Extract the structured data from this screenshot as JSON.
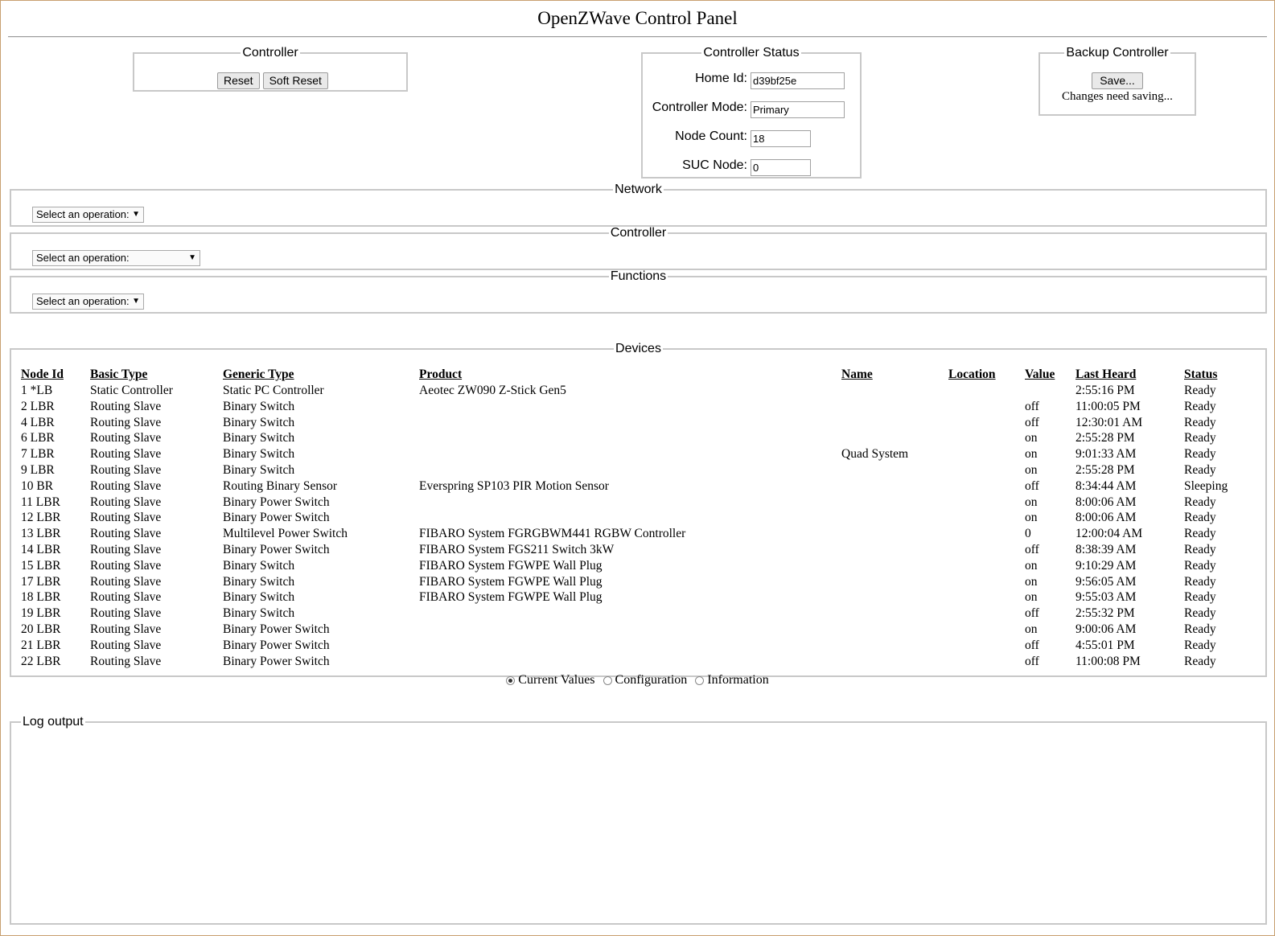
{
  "page": {
    "title": "OpenZWave Control Panel"
  },
  "controller": {
    "legend": "Controller",
    "reset_label": "Reset",
    "soft_reset_label": "Soft Reset"
  },
  "controller_status": {
    "legend": "Controller Status",
    "home_id_label": "Home Id:",
    "home_id": "d39bf25e",
    "mode_label": "Controller Mode:",
    "mode": "Primary",
    "node_count_label": "Node Count:",
    "node_count": "18",
    "suc_node_label": "SUC Node:",
    "suc_node": "0"
  },
  "backup": {
    "legend": "Backup Controller",
    "save_label": "Save...",
    "note": "Changes need saving..."
  },
  "network": {
    "legend": "Network",
    "select": "Select an operation:"
  },
  "controller_ops": {
    "legend": "Controller",
    "select": "Select an operation:"
  },
  "functions": {
    "legend": "Functions",
    "select": "Select an operation:"
  },
  "devices": {
    "legend": "Devices",
    "columns": [
      "Node Id",
      "Basic Type",
      "Generic Type",
      "Product",
      "Name",
      "Location",
      "Value",
      "Last Heard",
      "Status"
    ],
    "rows": [
      [
        "1 *LB",
        "Static Controller",
        "Static PC Controller",
        "Aeotec ZW090 Z-Stick Gen5",
        "",
        "",
        "",
        "2:55:16 PM",
        "Ready"
      ],
      [
        "2 LBR",
        "Routing Slave",
        "Binary Switch",
        "",
        "",
        "",
        "off",
        "11:00:05 PM",
        "Ready"
      ],
      [
        "4 LBR",
        "Routing Slave",
        "Binary Switch",
        "",
        "",
        "",
        "off",
        "12:30:01 AM",
        "Ready"
      ],
      [
        "6 LBR",
        "Routing Slave",
        "Binary Switch",
        "",
        "",
        "",
        "on",
        "2:55:28 PM",
        "Ready"
      ],
      [
        "7 LBR",
        "Routing Slave",
        "Binary Switch",
        "",
        "Quad System",
        "",
        "on",
        "9:01:33 AM",
        "Ready"
      ],
      [
        "9 LBR",
        "Routing Slave",
        "Binary Switch",
        "",
        "",
        "",
        "on",
        "2:55:28 PM",
        "Ready"
      ],
      [
        "10 BR",
        "Routing Slave",
        "Routing Binary Sensor",
        "Everspring SP103 PIR Motion Sensor",
        "",
        "",
        "off",
        "8:34:44 AM",
        "Sleeping"
      ],
      [
        "11 LBR",
        "Routing Slave",
        "Binary Power Switch",
        "",
        "",
        "",
        "on",
        "8:00:06 AM",
        "Ready"
      ],
      [
        "12 LBR",
        "Routing Slave",
        "Binary Power Switch",
        "",
        "",
        "",
        "on",
        "8:00:06 AM",
        "Ready"
      ],
      [
        "13 LBR",
        "Routing Slave",
        "Multilevel Power Switch",
        "FIBARO System FGRGBWM441 RGBW Controller",
        "",
        "",
        "0",
        "12:00:04 AM",
        "Ready"
      ],
      [
        "14 LBR",
        "Routing Slave",
        "Binary Power Switch",
        "FIBARO System FGS211 Switch 3kW",
        "",
        "",
        "off",
        "8:38:39 AM",
        "Ready"
      ],
      [
        "15 LBR",
        "Routing Slave",
        "Binary Switch",
        "FIBARO System FGWPE Wall Plug",
        "",
        "",
        "on",
        "9:10:29 AM",
        "Ready"
      ],
      [
        "17 LBR",
        "Routing Slave",
        "Binary Switch",
        "FIBARO System FGWPE Wall Plug",
        "",
        "",
        "on",
        "9:56:05 AM",
        "Ready"
      ],
      [
        "18 LBR",
        "Routing Slave",
        "Binary Switch",
        "FIBARO System FGWPE Wall Plug",
        "",
        "",
        "on",
        "9:55:03 AM",
        "Ready"
      ],
      [
        "19 LBR",
        "Routing Slave",
        "Binary Switch",
        "",
        "",
        "",
        "off",
        "2:55:32 PM",
        "Ready"
      ],
      [
        "20 LBR",
        "Routing Slave",
        "Binary Power Switch",
        "",
        "",
        "",
        "on",
        "9:00:06 AM",
        "Ready"
      ],
      [
        "21 LBR",
        "Routing Slave",
        "Binary Power Switch",
        "",
        "",
        "",
        "off",
        "4:55:01 PM",
        "Ready"
      ],
      [
        "22 LBR",
        "Routing Slave",
        "Binary Power Switch",
        "",
        "",
        "",
        "off",
        "11:00:08 PM",
        "Ready"
      ]
    ]
  },
  "view_options": {
    "current_values": "Current Values",
    "configuration": "Configuration",
    "information": "Information",
    "selected": "current_values"
  },
  "log": {
    "legend": "Log output",
    "text": ""
  }
}
